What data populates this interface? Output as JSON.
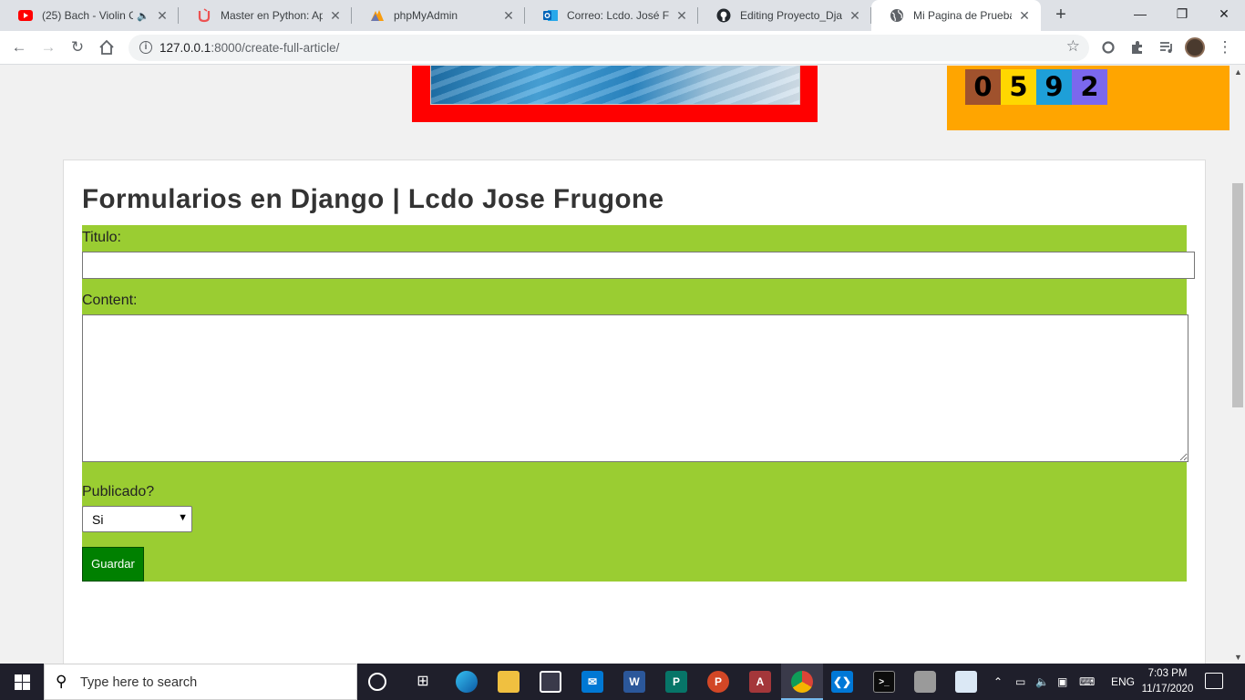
{
  "browser": {
    "tabs": [
      {
        "title": "(25) Bach - Violin C",
        "icon": "youtube-icon",
        "audio": true
      },
      {
        "title": "Master en Python: Apre",
        "icon": "udemy-icon"
      },
      {
        "title": "phpMyAdmin",
        "icon": "phpmyadmin-icon"
      },
      {
        "title": "Correo: Lcdo. José Ferna",
        "icon": "outlook-icon"
      },
      {
        "title": "Editing Proyecto_Djang",
        "icon": "github-icon"
      },
      {
        "title": "Mi Pagina de Pruebas",
        "icon": "globe-icon",
        "active": true
      }
    ],
    "url_host": "127.0.0.1",
    "url_rest": ":8000/create-full-article/"
  },
  "page": {
    "counter_digits": [
      "0",
      "5",
      "9",
      "2"
    ],
    "heading": "Formularios en Django | Lcdo Jose Frugone",
    "form": {
      "titulo_label": "Titulo:",
      "titulo_value": "",
      "content_label": "Content:",
      "content_value": "",
      "publicado_label": "Publicado?",
      "publicado_value": "Si",
      "submit_label": "Guardar"
    }
  },
  "taskbar": {
    "search_placeholder": "Type here to search",
    "language": "ENG",
    "time": "7:03 PM",
    "date": "11/17/2020"
  },
  "colors": {
    "form_background": "#9acd32",
    "submit_button": "#008000",
    "banner_frame": "#ff0000",
    "counter_box": "#ffa500"
  }
}
